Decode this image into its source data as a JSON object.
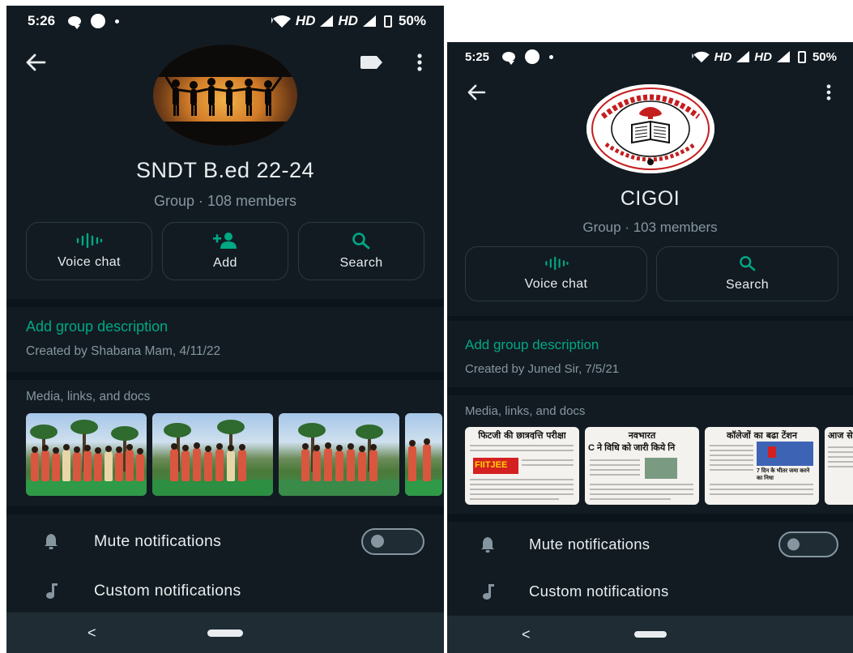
{
  "colors": {
    "background": "#121b22",
    "accent": "#00a884",
    "text_primary": "#e9edef",
    "text_secondary": "#8696a0",
    "divider": "#0b141a",
    "navbar": "#1f2c34"
  },
  "left": {
    "status_bar": {
      "time": "5:26",
      "network_label_1": "HD",
      "network_label_2": "HD",
      "battery": "50%"
    },
    "header": {
      "back_icon": "arrow-left-icon",
      "label_icon": "label-tag-icon",
      "menu_icon": "more-vertical-icon"
    },
    "group": {
      "name": "SNDT B.ed 22-24",
      "subtitle": "Group · 108 members"
    },
    "actions": [
      {
        "label": "Voice chat",
        "icon": "voice-wave-icon"
      },
      {
        "label": "Add",
        "icon": "add-person-icon"
      },
      {
        "label": "Search",
        "icon": "search-icon"
      }
    ],
    "description": {
      "add_label": "Add group description",
      "created": "Created by Shabana Mam, 4/11/22"
    },
    "media": {
      "title": "Media, links, and docs"
    },
    "settings": {
      "mute": "Mute notifications",
      "mute_enabled": false,
      "custom": "Custom notifications"
    },
    "nav": {
      "back": "<"
    }
  },
  "right": {
    "status_bar": {
      "time": "5:25",
      "network_label_1": "HD",
      "network_label_2": "HD",
      "battery": "50%"
    },
    "header": {
      "back_icon": "arrow-left-icon",
      "menu_icon": "more-vertical-icon"
    },
    "group": {
      "name": "CIGOI",
      "subtitle": "Group · 103 members"
    },
    "actions": [
      {
        "label": "Voice chat",
        "icon": "voice-wave-icon"
      },
      {
        "label": "Search",
        "icon": "search-icon"
      }
    ],
    "description": {
      "add_label": "Add group description",
      "created": "Created by Juned Sir, 7/5/21"
    },
    "media": {
      "title": "Media, links, and docs",
      "thumb_headlines": [
        "फिटजी की छात्रवृत्ति परीक्षा",
        "नवभारत",
        "कॉलेजों का बढ़ा टेंशन",
        "आज से"
      ],
      "thumb_sub_headlines": [
        "FIITJEE",
        "C ने विधि को जारी किये नि",
        "7 दिन के भीतर जमा करने का निधा"
      ]
    },
    "settings": {
      "mute": "Mute notifications",
      "mute_enabled": false,
      "custom": "Custom notifications"
    },
    "nav": {
      "back": "<"
    }
  }
}
